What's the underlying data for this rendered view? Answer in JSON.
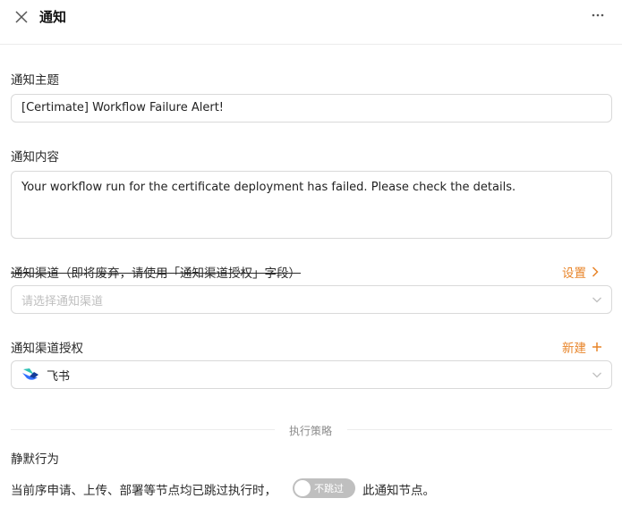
{
  "header": {
    "title": "通知",
    "more_icon": "ellipsis-icon",
    "close_icon": "close-icon"
  },
  "subject": {
    "label": "通知主题",
    "value": "[Certimate] Workflow Failure Alert!"
  },
  "content": {
    "label": "通知内容",
    "value": "Your workflow run for the certificate deployment has failed. Please check the details."
  },
  "channel": {
    "label": "通知渠道（即将废弃，请使用「通知渠道授权」字段）",
    "settings_label": "设置",
    "placeholder": "请选择通知渠道"
  },
  "channel_auth": {
    "label": "通知渠道授权",
    "new_label": "新建",
    "selected_value": "飞书",
    "selected_icon": "feishu-logo-icon"
  },
  "strategy": {
    "divider_label": "执行策略",
    "silent_label": "静默行为",
    "sentence_prefix": "当前序申请、上传、部署等节点均已跳过执行时，",
    "toggle_label": "不跳过",
    "sentence_suffix": "此通知节点。"
  },
  "colors": {
    "accent": "#e8852a",
    "border": "#d9d9d9",
    "toggle_off": "#bfbfbf"
  }
}
